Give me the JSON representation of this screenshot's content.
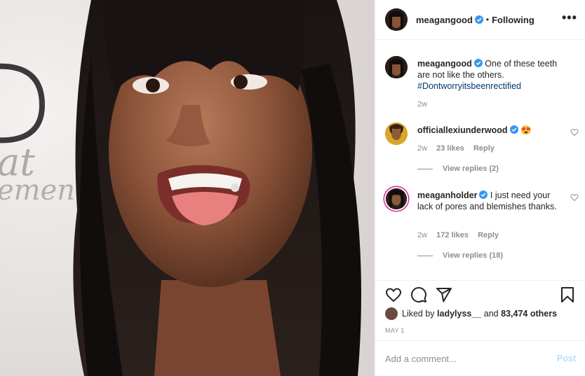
{
  "photo": {
    "alt_icon": "portrait-photo"
  },
  "header": {
    "username": "meagangood",
    "separator": "•",
    "follow_status": "Following",
    "more": "•••"
  },
  "caption": {
    "username": "meagangood",
    "text": "One of these teeth are not like the others.",
    "hashtag": "#Dontworryitsbeenrectified",
    "time": "2w"
  },
  "comments": [
    {
      "username": "officiallexiunderwood",
      "text": "😍",
      "time": "2w",
      "likes": "23 likes",
      "reply": "Reply",
      "view_replies": "View replies (2)"
    },
    {
      "username": "meaganholder",
      "text": "I just need your lack of pores and blemishes thanks.",
      "time": "2w",
      "likes": "172 likes",
      "reply": "Reply",
      "view_replies": "View replies (18)"
    }
  ],
  "likes": {
    "prefix": "Liked by ",
    "first_user": "ladylyss__",
    "joiner": " and ",
    "others": "83,474 others"
  },
  "date": "MAY 1",
  "add_comment": {
    "placeholder": "Add a comment...",
    "post_label": "Post"
  },
  "colors": {
    "verified": "#3897f0",
    "link": "#00376b",
    "muted": "#8e8e8e",
    "post_disabled": "#b2dffc"
  }
}
